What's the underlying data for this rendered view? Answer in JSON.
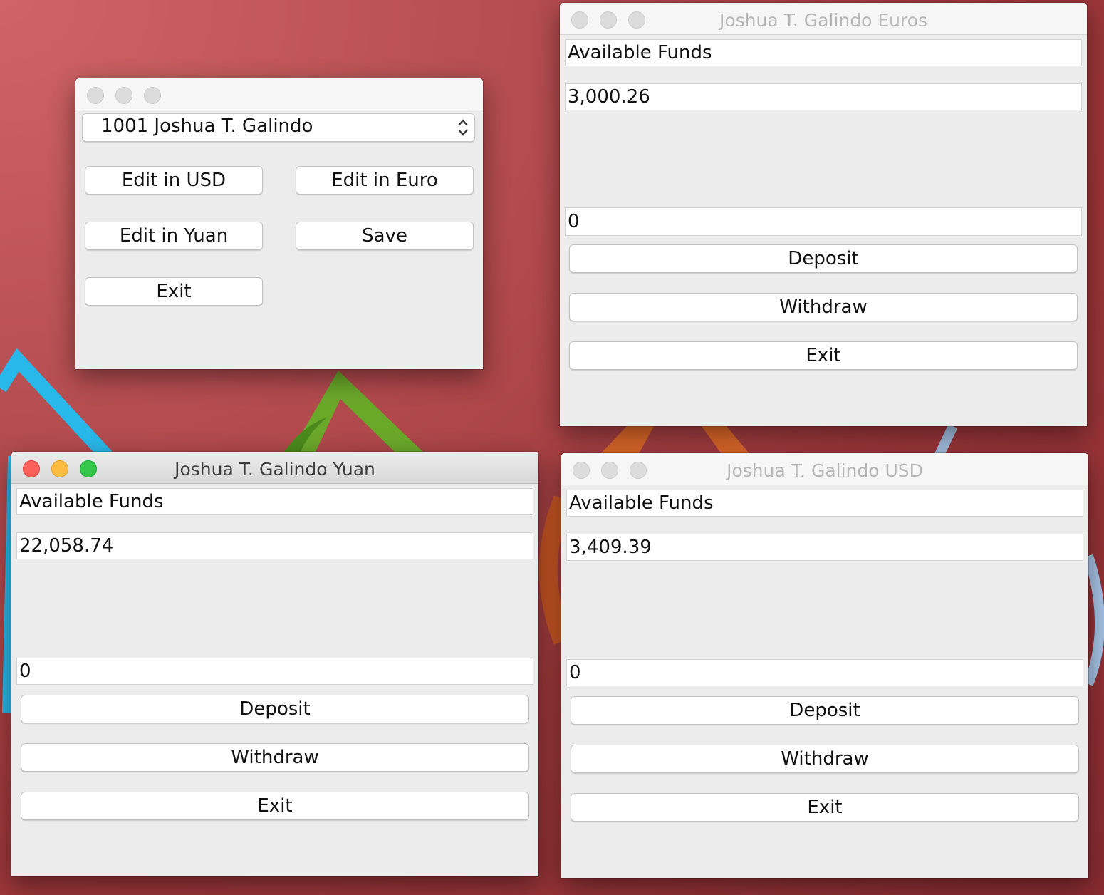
{
  "main_window": {
    "account_select": "1001  Joshua T. Galindo",
    "buttons": {
      "edit_usd": "Edit in USD",
      "edit_euro": "Edit in Euro",
      "edit_yuan": "Edit in Yuan",
      "save": "Save",
      "exit": "Exit"
    }
  },
  "euro_window": {
    "title": "Joshua T. Galindo  Euros",
    "funds_label": "Available Funds",
    "funds_value": "3,000.26",
    "amount_value": "0",
    "deposit_label": "Deposit",
    "withdraw_label": "Withdraw",
    "exit_label": "Exit"
  },
  "yuan_window": {
    "title": "Joshua T. Galindo  Yuan",
    "funds_label": "Available Funds",
    "funds_value": "22,058.74",
    "amount_value": "0",
    "deposit_label": "Deposit",
    "withdraw_label": "Withdraw",
    "exit_label": "Exit"
  },
  "usd_window": {
    "title": "Joshua T. Galindo  USD",
    "funds_label": "Available Funds",
    "funds_value": "3,409.39",
    "amount_value": "0",
    "deposit_label": "Deposit",
    "withdraw_label": "Withdraw",
    "exit_label": "Exit"
  },
  "colors": {
    "desktop": "#a83e42",
    "close": "#fc605b",
    "minimize": "#fdbc40",
    "zoom": "#34c84a"
  }
}
